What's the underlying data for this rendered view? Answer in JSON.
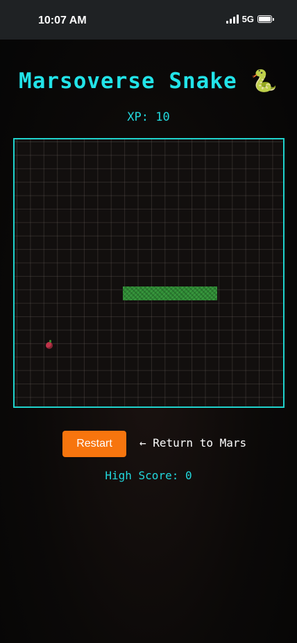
{
  "status": {
    "time": "10:07 AM",
    "network": "5G"
  },
  "game": {
    "title": "Marsoverse Snake",
    "title_emoji": "🐍",
    "xp_label": "XP:",
    "xp_value": "10",
    "snake_segments": 7,
    "colors": {
      "accent": "#22e3e8",
      "board_border": "#1fd3cd",
      "snake": "#2e8a34",
      "restart_button": "#f7750e"
    }
  },
  "controls": {
    "restart_label": "Restart",
    "return_label": "← Return to Mars"
  },
  "footer": {
    "high_score_label": "High Score:",
    "high_score_value": "0"
  }
}
